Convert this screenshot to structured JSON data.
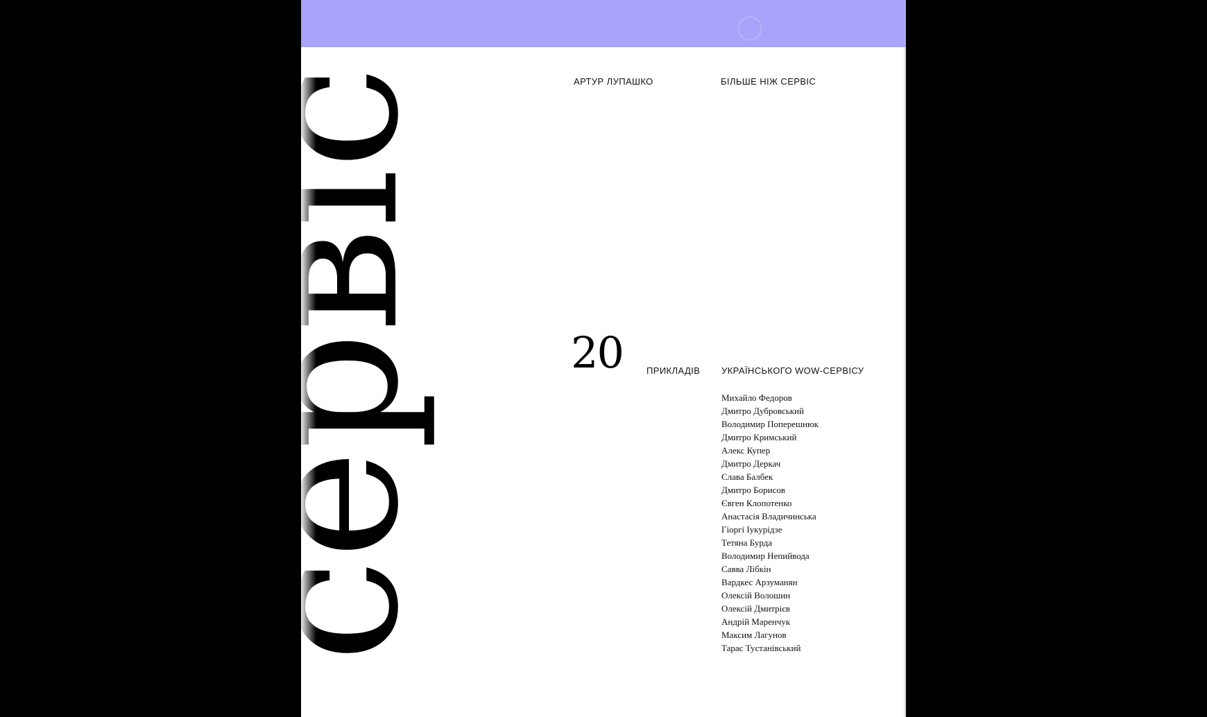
{
  "cover": {
    "band_color": "#a9a4fb",
    "vertical_title": "сервіс",
    "author": "АРТУР ЛУПАШКО",
    "subtitle": "БІЛЬШЕ НІЖ СЕРВІС",
    "count": "20",
    "examples_label": "ПРИКЛАДІВ",
    "wow_label": "УКРАЇНСЬКОГО WOW-СЕРВІСУ",
    "names": [
      "Михайло Федоров",
      "Дмитро Дубровський",
      "Володимир Поперешнюк",
      "Дмитро Кримський",
      "Алекс Купер",
      "Дмитро Деркач",
      "Слава Балбек",
      "Дмитро Борисов",
      "Євген Клопотенко",
      "Анастасія Владичинська",
      "Гіоргі Іукурідзе",
      "Тетяна Бурда",
      "Володимир Непийвода",
      "Савва Лібкін",
      "Вардкес Арзуманян",
      "Олексій Волошин",
      "Олексій Дмитрієв",
      "Андрій Маренчук",
      "Максим Лагунов",
      "Тарас Тустанівський"
    ]
  }
}
